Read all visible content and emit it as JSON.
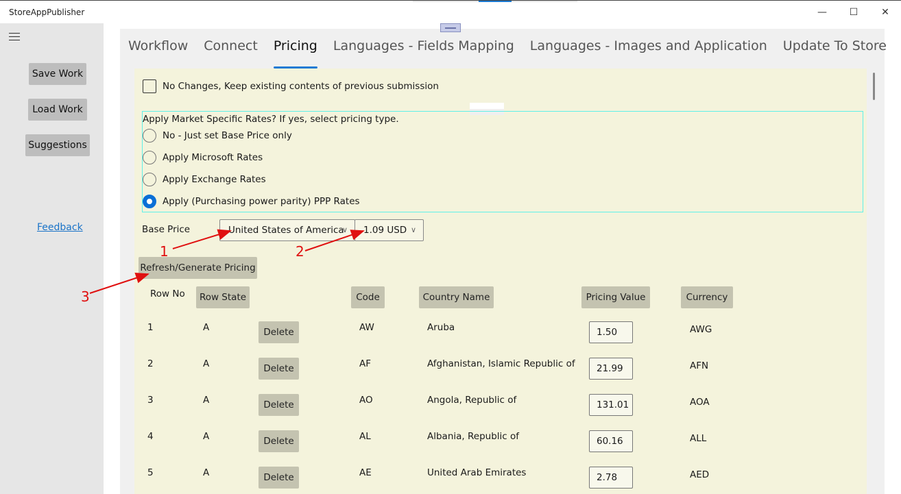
{
  "window": {
    "title": "StoreAppPublisher",
    "controls": {
      "minimize": "—",
      "maximize": "☐",
      "close": "✕"
    }
  },
  "sidebar": {
    "menu_icon": "hamburger-icon",
    "buttons": [
      "Save Work",
      "Load Work",
      "Suggestions"
    ],
    "feedback_link": "Feedback"
  },
  "tabs": [
    {
      "label": "Workflow",
      "active": false
    },
    {
      "label": "Connect",
      "active": false
    },
    {
      "label": "Pricing",
      "active": true
    },
    {
      "label": "Languages - Fields Mapping",
      "active": false
    },
    {
      "label": "Languages - Images and Application",
      "active": false
    },
    {
      "label": "Update To Store",
      "active": false
    }
  ],
  "pricing": {
    "no_changes_label": "No Changes, Keep existing contents of previous submission",
    "no_changes_checked": false,
    "rates_question": "Apply Market Specific Rates?  If yes, select pricing type.",
    "rate_options": [
      {
        "label": "No - Just set Base Price only",
        "checked": false
      },
      {
        "label": "Apply Microsoft Rates",
        "checked": false
      },
      {
        "label": "Apply Exchange Rates",
        "checked": false
      },
      {
        "label": "Apply (Purchasing power parity) PPP Rates",
        "checked": true
      }
    ],
    "base_price_label": "Base Price",
    "base_country": "United States of America",
    "base_price": "1.09 USD",
    "refresh_button": "Refresh/Generate Pricing",
    "columns": {
      "row_no": "Row No",
      "row_state": "Row State",
      "code": "Code",
      "country_name": "Country Name",
      "pricing_value": "Pricing Value",
      "currency": "Currency"
    },
    "delete_label": "Delete",
    "rows": [
      {
        "no": "1",
        "state": "A",
        "code": "AW",
        "country": "Aruba",
        "price": "1.50",
        "currency": "AWG"
      },
      {
        "no": "2",
        "state": "A",
        "code": "AF",
        "country": "Afghanistan, Islamic Republic of",
        "price": "21.99",
        "currency": "AFN"
      },
      {
        "no": "3",
        "state": "A",
        "code": "AO",
        "country": "Angola, Republic of",
        "price": "131.01",
        "currency": "AOA"
      },
      {
        "no": "4",
        "state": "A",
        "code": "AL",
        "country": "Albania, Republic of",
        "price": "60.16",
        "currency": "ALL"
      },
      {
        "no": "5",
        "state": "A",
        "code": "AE",
        "country": "United Arab Emirates",
        "price": "2.78",
        "currency": "AED"
      }
    ]
  },
  "annotations": [
    "1",
    "2",
    "3"
  ],
  "colors": {
    "accent": "#1a7ad4",
    "panel": "#f4f3dc",
    "annotation": "#e01010",
    "group_border": "#5ff0e8"
  }
}
